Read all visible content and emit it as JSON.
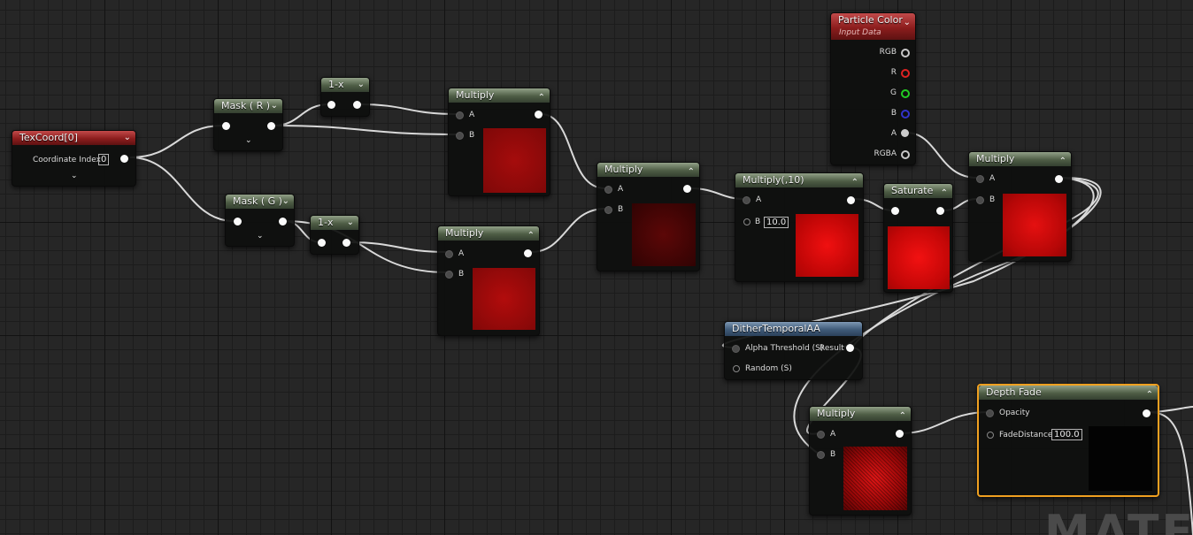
{
  "watermark": "MATER",
  "nodes": {
    "texcoord": {
      "title": "TexCoord[0]",
      "coordinate_label": "Coordinate Index",
      "coordinate_value": "0"
    },
    "mask_r": {
      "title": "Mask ( R )"
    },
    "mask_g": {
      "title": "Mask ( G )"
    },
    "one_minus_1": {
      "title": "1-x"
    },
    "one_minus_2": {
      "title": "1-x"
    },
    "multiply_1": {
      "title": "Multiply",
      "a": "A",
      "b": "B"
    },
    "multiply_2": {
      "title": "Multiply",
      "a": "A",
      "b": "B"
    },
    "multiply_3": {
      "title": "Multiply",
      "a": "A",
      "b": "B"
    },
    "multiply_10": {
      "title": "Multiply(,10)",
      "a": "A",
      "b": "B",
      "b_value": "10.0"
    },
    "saturate": {
      "title": "Saturate"
    },
    "particle_color": {
      "title": "Particle Color",
      "subtitle": "Input Data",
      "outputs": [
        "RGB",
        "R",
        "G",
        "B",
        "A",
        "RGBA"
      ]
    },
    "multiply_4": {
      "title": "Multiply",
      "a": "A",
      "b": "B"
    },
    "dither": {
      "title": "DitherTemporalAA",
      "alpha_threshold": "Alpha Threshold (S)",
      "result": "Result",
      "random": "Random (S)"
    },
    "multiply_5": {
      "title": "Multiply",
      "a": "A",
      "b": "B"
    },
    "depth_fade": {
      "title": "Depth Fade",
      "opacity": "Opacity",
      "fade_distance": "FadeDistance",
      "fade_value": "100.0"
    }
  },
  "colors": {
    "wire": "#d9d9d9",
    "selected_border": "#f0a020",
    "r_pin": "#d22",
    "g_pin": "#2c2",
    "b_pin": "#33c"
  }
}
